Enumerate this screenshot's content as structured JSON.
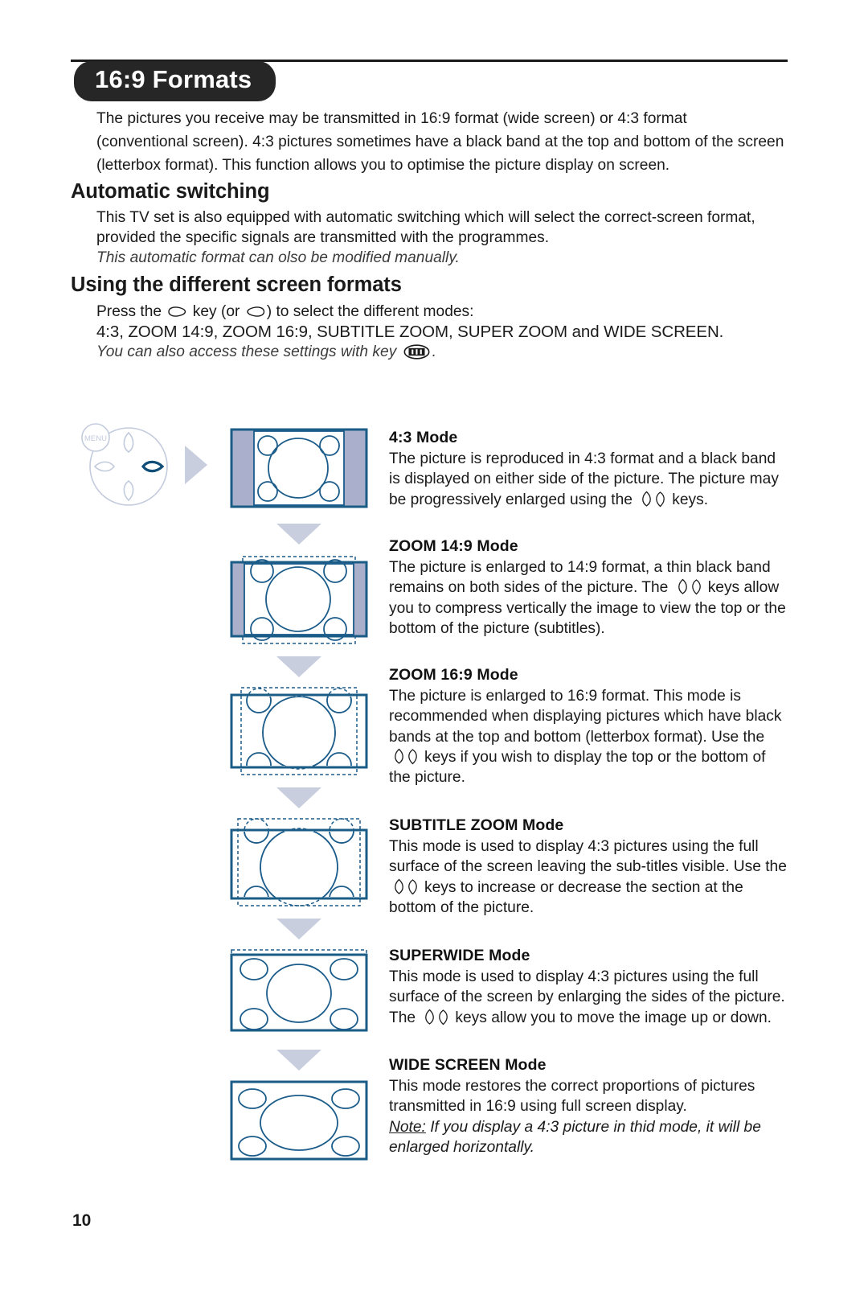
{
  "header": {
    "title": "16:9 Formats"
  },
  "intro": {
    "line1": "The pictures you receive may be transmitted in 16:9 format (wide screen) or 4:3 format",
    "line2": "(conventional screen). 4:3 pictures sometimes have a black band at the top and bottom of the screen",
    "line3": "(letterbox format). This function allows you to optimise the picture display on screen."
  },
  "automatic": {
    "heading": "Automatic switching",
    "body": "This TV set is also equipped with automatic switching which will select the correct-screen format, provided the specific signals are transmitted with the programmes.",
    "italic": "This automatic format can olso be modified manually."
  },
  "using": {
    "heading": "Using the different screen formats",
    "press_pre": "Press the",
    "press_mid": "key (or",
    "press_post": ") to select the different modes:",
    "modes_line": "4:3, ZOOM 14:9, ZOOM 16:9, SUBTITLE ZOOM, SUPER ZOOM and WIDE SCREEN.",
    "access_pre": "You can also access these settings with key",
    "access_post": "."
  },
  "modes": [
    {
      "title": "4:3 Mode",
      "body_pre": "The picture is reproduced in 4:3 format and a black band is displayed on either side of the picture. The picture may be progressively enlarged using the",
      "body_post": "keys.",
      "diagram": "tv-4-3"
    },
    {
      "title": "ZOOM 14:9 Mode",
      "body_pre": "The picture is enlarged to 14:9 format, a thin black band remains on both sides of the picture. The",
      "body_post": "keys allow you to compress vertically the image to view the top or the bottom of the picture (subtitles).",
      "diagram": "tv-zoom-14-9"
    },
    {
      "title": "ZOOM 16:9 Mode",
      "body_pre": "The picture is enlarged to 16:9 format. This mode is recommended when displaying pictures which have black bands at the top and bottom (letterbox format). Use the",
      "body_post": "keys if you wish to display the top or the bottom of the picture.",
      "diagram": "tv-zoom-16-9"
    },
    {
      "title": "SUBTITLE ZOOM Mode",
      "body_pre": "This mode is used to display 4:3 pictures using the full surface of the screen leaving the sub-titles visible. Use the",
      "body_post": "keys to increase or decrease the section at the bottom of the picture.",
      "diagram": "tv-subtitle-zoom"
    },
    {
      "title": "SUPERWIDE Mode",
      "body_pre": "This mode is used to display 4:3 pictures using the full surface of the screen by enlarging the sides of the picture. The",
      "body_post": "keys allow you to move the image up or down.",
      "diagram": "tv-superwide"
    },
    {
      "title": "WIDE SCREEN Mode",
      "body_pre": "This mode restores the correct proportions of pictures transmitted in 16:9 using full screen display.",
      "body_post": "",
      "note_label": "Note:",
      "note_text": " If you display a 4:3 picture in thid mode, it will be enlarged horizontally.",
      "diagram": "tv-wide-screen"
    }
  ],
  "remote": {
    "menu_label": "MENU"
  },
  "footer": {
    "page_number": "10"
  },
  "colors": {
    "badge_bg": "#262626",
    "text": "#1a1a1a",
    "diagram_stroke": "#1b5c8a",
    "diagram_frame": "#1a5c85",
    "band_fill": "#aab0cc",
    "arrow_fill": "#c8cede",
    "remote_line": "#c3cbdd",
    "remote_active": "#124f78"
  }
}
